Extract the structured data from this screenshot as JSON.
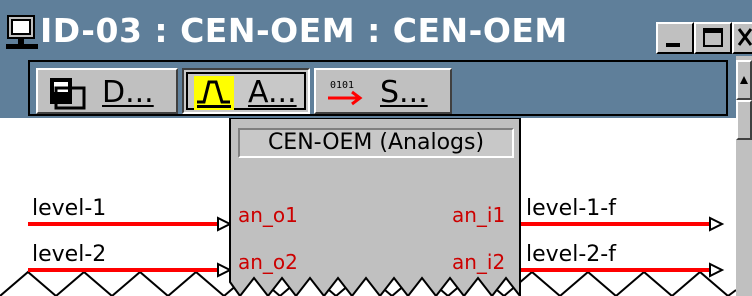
{
  "window": {
    "title": "ID-03 : CEN-OEM : CEN-OEM",
    "controls": [
      "minimize",
      "maximize",
      "close"
    ]
  },
  "toolbar": {
    "buttons": [
      {
        "label": "D...",
        "icon": "digital-block-icon",
        "pressed": false
      },
      {
        "label": "A...",
        "icon": "analog-wave-icon",
        "pressed": true
      },
      {
        "label": "S...",
        "icon": "serial-arrow-icon",
        "pressed": false
      }
    ]
  },
  "block": {
    "title": "CEN-OEM (Analogs)",
    "inputs": [
      "an_o1",
      "an_o2"
    ],
    "outputs": [
      "an_i1",
      "an_i2"
    ]
  },
  "signals": {
    "left": [
      "level-1",
      "level-2"
    ],
    "right": [
      "level-1-f",
      "level-2-f"
    ]
  },
  "colors": {
    "titlebar": "#5f7f9a",
    "signal_line": "#ff0000",
    "port_text": "#cc0000",
    "block_fill": "#c0c0c0"
  }
}
